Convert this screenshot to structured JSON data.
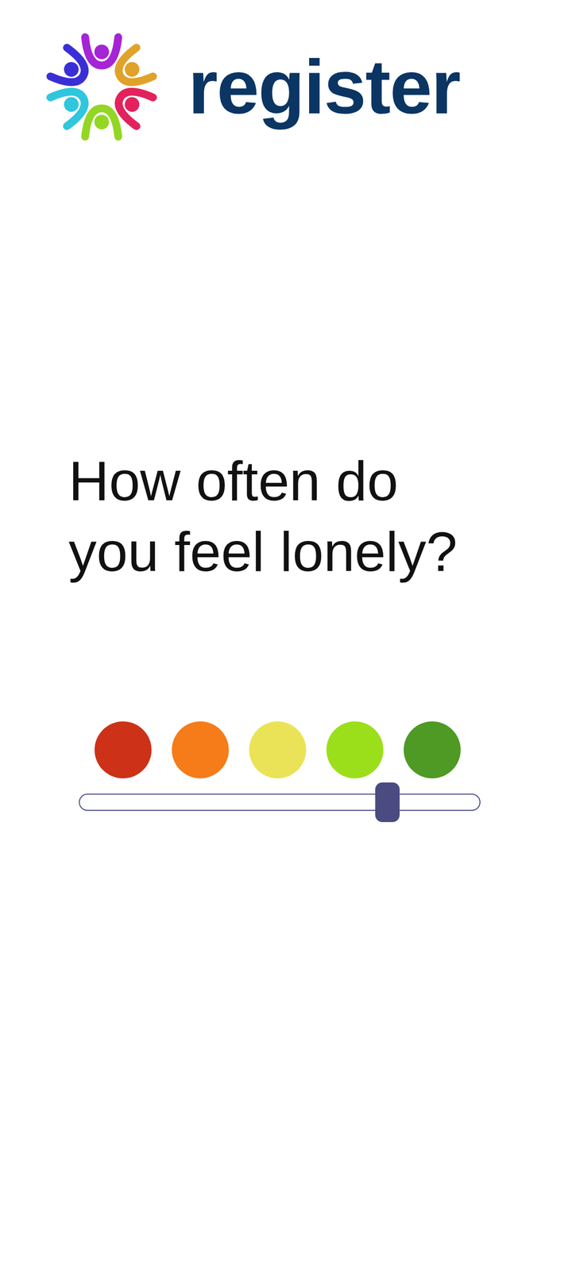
{
  "brand": {
    "name": "register"
  },
  "question": {
    "lines": [
      "How often do",
      "you feel lonely?"
    ]
  },
  "scale": {
    "options": [
      {
        "color": "#cd3118"
      },
      {
        "color": "#f57c18"
      },
      {
        "color": "#eae357"
      },
      {
        "color": "#9bdf1a"
      },
      {
        "color": "#4e9a24"
      }
    ],
    "level": 0.77
  }
}
